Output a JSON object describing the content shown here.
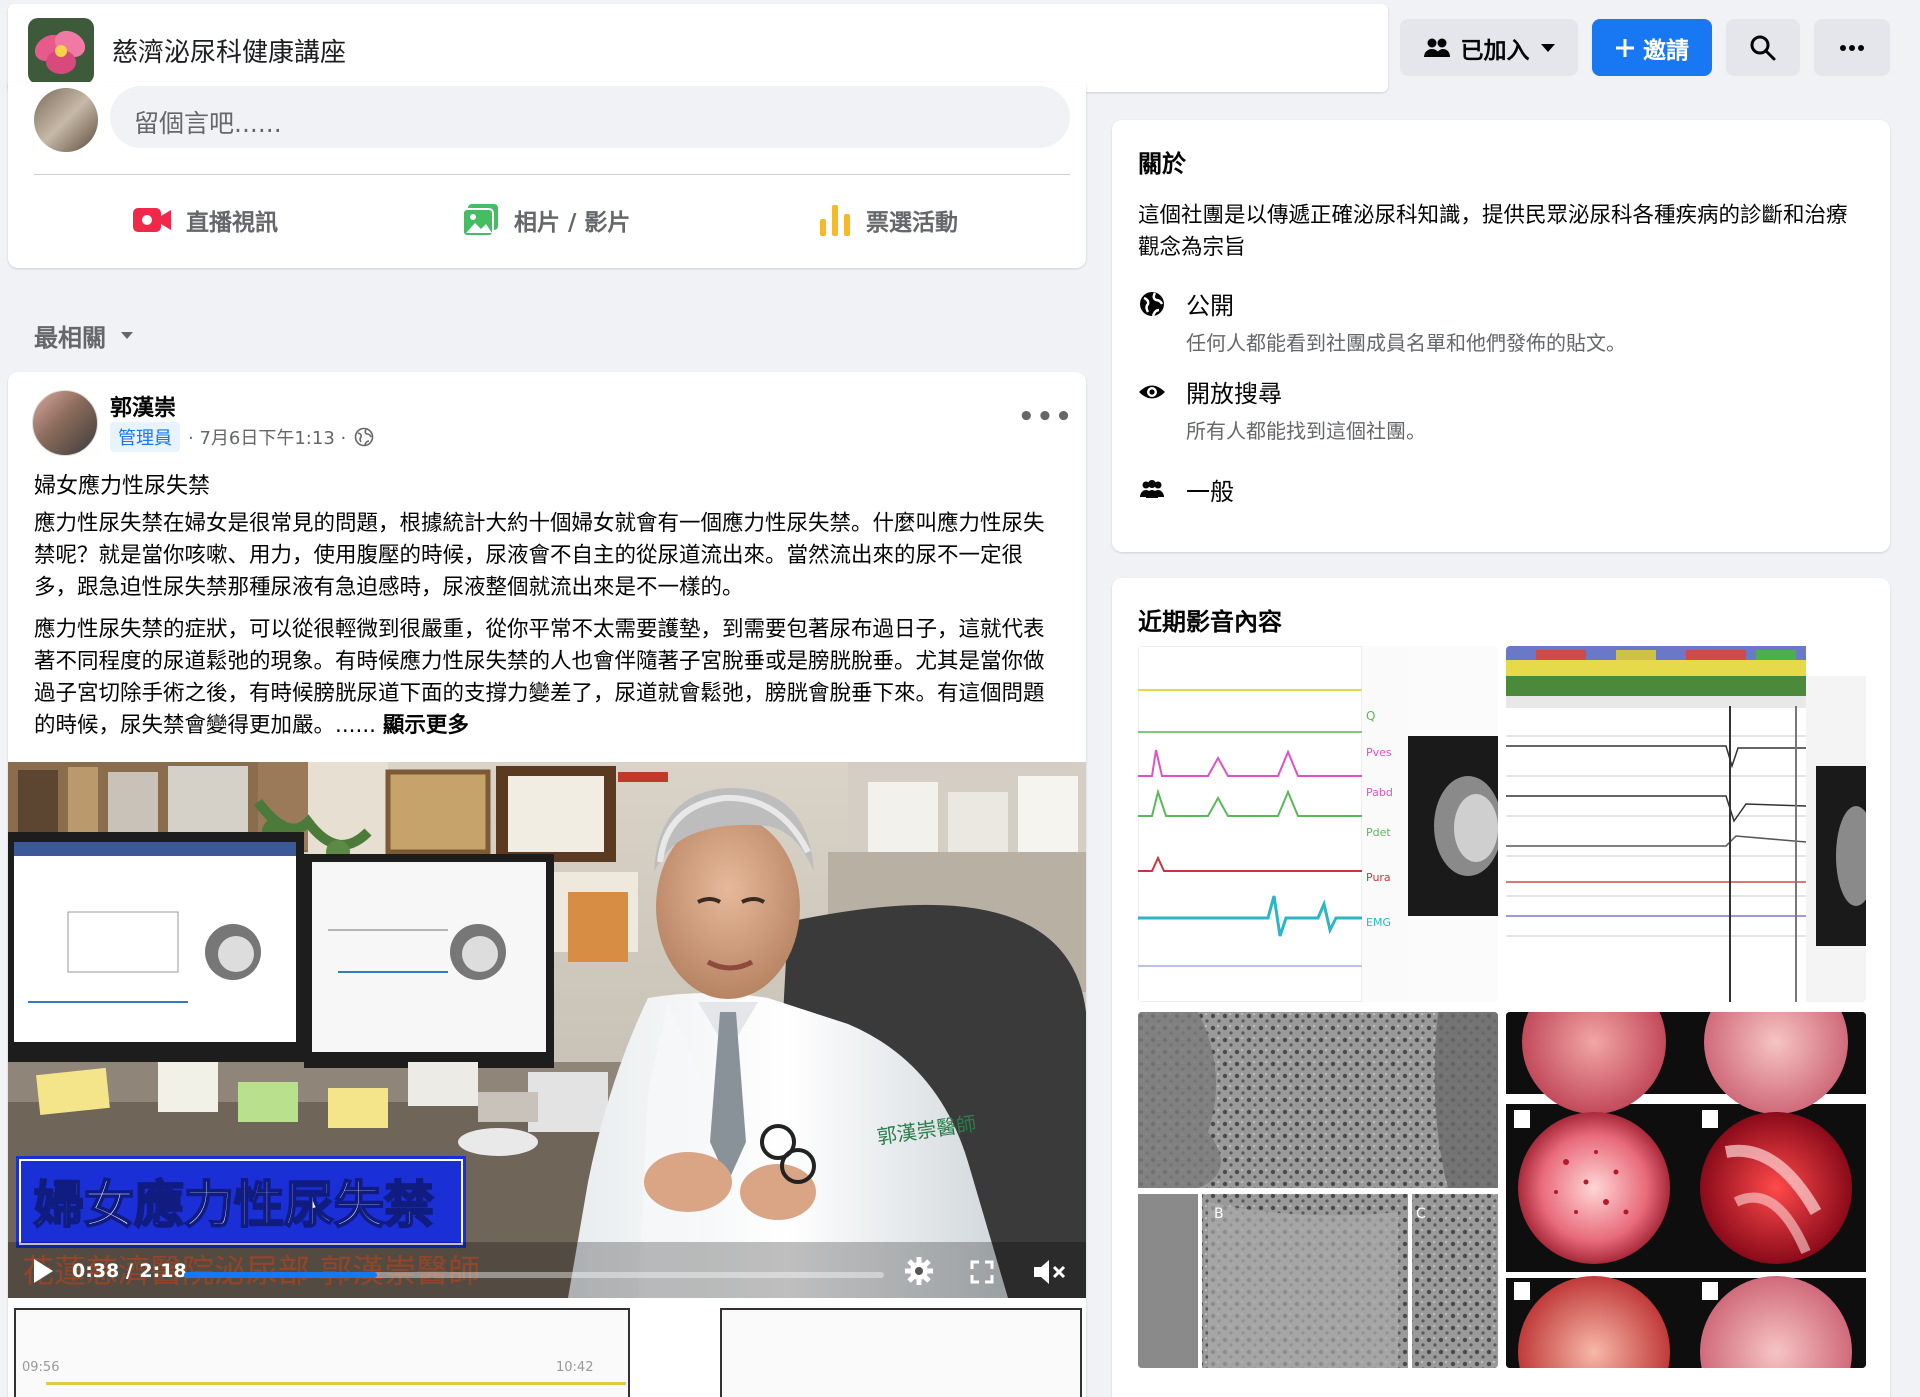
{
  "header": {
    "group_name": "慈濟泌尿科健康講座",
    "joined_label": "已加入",
    "invite_label": "邀請",
    "icons": [
      "members-icon",
      "caret-down-icon",
      "plus-icon",
      "search-icon",
      "more-icon"
    ]
  },
  "composer": {
    "placeholder": "留個言吧......",
    "actions": [
      {
        "label": "直播視訊",
        "icon": "live-video-icon",
        "color": "#f02849"
      },
      {
        "label": "相片 / 影片",
        "icon": "photo-icon",
        "color": "#45bd62"
      },
      {
        "label": "票選活動",
        "icon": "poll-icon",
        "color": "#f7b928"
      }
    ]
  },
  "feed": {
    "sort_label": "最相關"
  },
  "post": {
    "author": "郭漢崇",
    "role_badge": "管理員",
    "timestamp": "· 7月6日下午1:13 ·",
    "title": "婦女應力性尿失禁",
    "paragraph1": "應力性尿失禁在婦女是很常見的問題，根據統計大約十個婦女就會有一個應力性尿失禁。什麼叫應力性尿失禁呢？就是當你咳嗽、用力，使用腹壓的時候，尿液會不自主的從尿道流出來。當然流出來的尿不一定很多，跟急迫性尿失禁那種尿液有急迫感時，尿液整個就流出來是不一樣的。",
    "paragraph2": "應力性尿失禁的症狀，可以從很輕微到很嚴重，從你平常不太需要護墊，到需要包著尿布過日子，這就代表著不同程度的尿道鬆弛的現象。有時候應力性尿失禁的人也會伴隨著子宮脫垂或是膀胱脫垂。尤其是當你做過子宮切除手術之後，有時候膀胱尿道下面的支撐力變差了，尿道就會鬆弛，膀胱會脫垂下來。有這個問題的時候，尿失禁會變得更加嚴。......",
    "see_more": "顯示更多",
    "video": {
      "caption_title": "婦女應力性尿失禁",
      "subtitle": "花蓮慈濟醫院泌尿部 郭漢崇醫師",
      "time": "0:38 / 2:18",
      "progress": 0.275,
      "coat_label": "郭漢崇醫師",
      "chart_ticks": [
        "09:56",
        "10:42"
      ]
    }
  },
  "about": {
    "title": "關於",
    "description": "這個社團是以傳遞正確泌尿科知識，提供民眾泌尿科各種疾病的診斷和治療觀念為宗旨",
    "privacy_title": "公開",
    "privacy_sub": "任何人都能看到社團成員名單和他們發佈的貼文。",
    "visibility_title": "開放搜尋",
    "visibility_sub": "所有人都能找到這個社團。",
    "type_title": "一般"
  },
  "media": {
    "title": "近期影音內容"
  }
}
